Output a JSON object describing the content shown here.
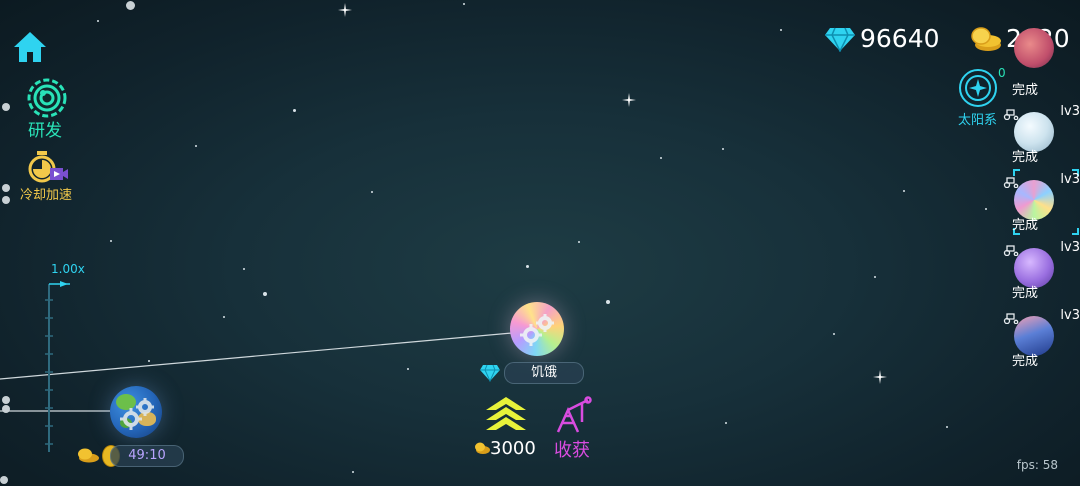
{
  "currency": {
    "gems": "96640",
    "coins": "2020"
  },
  "left_menu": {
    "research_label": "研发",
    "cooldown_label": "冷却加速"
  },
  "speed": {
    "multiplier": "1.00x"
  },
  "solar_system": {
    "label": "太阳系",
    "count": "0"
  },
  "center_planet": {
    "status_label": "饥饿",
    "upgrade_cost": "3000",
    "harvest_label": "收获"
  },
  "home_planet": {
    "timer": "49:10"
  },
  "side_planets": [
    {
      "level": "",
      "status": "完成"
    },
    {
      "level": "lv3",
      "status": "完成"
    },
    {
      "level": "lv3",
      "status": "完成"
    },
    {
      "level": "lv3",
      "status": "完成"
    },
    {
      "level": "lv3",
      "status": "完成"
    }
  ],
  "fps": "fps: 58",
  "colors": {
    "accent_teal": "#29e3b8",
    "gem_cyan": "#2fd3f0",
    "coin_gold": "#f2c230",
    "upgrade_yellow": "#e7f23a",
    "harvest_magenta": "#d94ce0",
    "timer_purple": "#b9a4ff"
  },
  "icons": [
    "home-icon",
    "research-icon",
    "cooldown-timer-icon",
    "video-ad-icon",
    "gem-icon",
    "coin-icon",
    "solar-system-icon",
    "upgrade-arrows-icon",
    "oil-derrick-icon",
    "tractor-icon",
    "gear-icon"
  ]
}
